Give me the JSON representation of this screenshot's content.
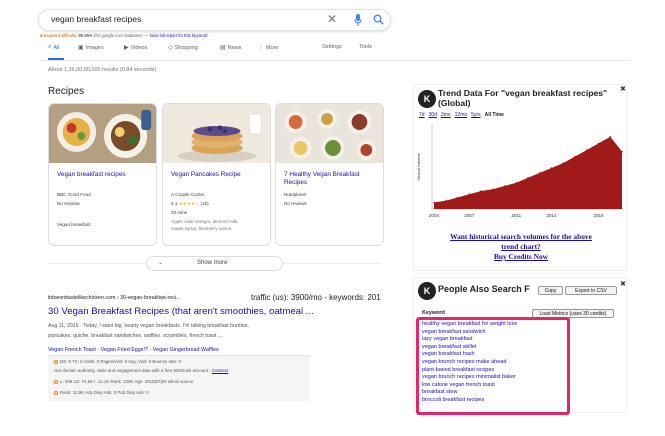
{
  "search": {
    "query": "vegan breakfast recipes",
    "keyword_difficulty_label": "Keyword difficulty:",
    "keyword_difficulty_value": "86.95%",
    "keyword_difficulty_note": "(for google.com database) —",
    "keyword_difficulty_link": "View full report for this keyword"
  },
  "tabs": [
    {
      "label": "All",
      "icon": "search-icon"
    },
    {
      "label": "Images",
      "icon": "image-icon"
    },
    {
      "label": "Videos",
      "icon": "video-icon"
    },
    {
      "label": "Shopping",
      "icon": "tag-icon"
    },
    {
      "label": "News",
      "icon": "news-icon"
    },
    {
      "label": "More",
      "icon": "more-icon"
    },
    {
      "label": "Settings"
    },
    {
      "label": "Tools"
    }
  ],
  "results_count": "About 1,26,00,00,000 results (0.84 seconds)",
  "recipes": {
    "title": "Recipes",
    "cards": [
      {
        "title": "Vegan breakfast recipes",
        "source": "BBC Good Food",
        "reviews": "No reviews",
        "extra": "Vegan breakfast"
      },
      {
        "title": "Vegan Pancakes Recipe",
        "source": "A Couple Cooks",
        "rating": "4.1",
        "stars": "★★★★☆",
        "count": "(18)",
        "time": "20 mins",
        "ingredients_1": "Apple cider vinegar, almond milk,",
        "ingredients_2": "maple syrup, blueberry sauce,"
      },
      {
        "title": "7 Healthy Vegan Breakfast Recipes",
        "source": "Nutriplanet",
        "reviews": "No reviews"
      }
    ],
    "show_more": "Show more"
  },
  "result": {
    "url": "itdoesnttastelikechicken.com › 30-vegan-breakfast-reci...",
    "traffic": "traffic (us): 3900/mo - keywords: 201",
    "title": "30 Vegan Breakfast Recipes (that aren't smoothies, oatmeal ...",
    "snippet_1": "Aug 11, 2016 · Today, I want big, hearty vegan breakfasts. I'm talking breakfast burritos,",
    "snippet_2": "pancakes, quiche, breakfast sandwiches, waffles, scrambles, french toast ...",
    "links": "Vegan French Toast · Vegan Fried Eggs!? · Vegan Gingerbread Waffles"
  },
  "seo_bar": {
    "line1": "DS: 0   TS: 0   Visits: 0   Pages/Visit: 0   Avg. Visit: 0   Bounce rate: 0",
    "line2": "Get domain authority, visits and engagement data with a free SEMrush account -",
    "line2_link": "Connect",
    "line3": "L: 399   LD: 74.5K   I: 14.1K   Rank: 109K   Age: 2015|07|06   whois   source",
    "line4": "Rank: 12.9K   Adv Disp Ads: 0   Pub Disp Ads: 0"
  },
  "trend": {
    "logo": "K",
    "title": "Trend Data For \"vegan breakfast recipes\" (Global)",
    "ranges": [
      "7d",
      "30d",
      "3mo",
      "12mo",
      "5yrs",
      "All Time"
    ],
    "selected_range": "All Time",
    "link_1": "Want historical search volumes for the above",
    "link_2": "trend chart?",
    "link_3": "Buy Credits Now"
  },
  "chart_data": {
    "type": "area",
    "ylabel": "Search Interest",
    "x_ticks": [
      "2004",
      "2007",
      "2011",
      "2014",
      "2018"
    ],
    "x": [
      2004,
      2005,
      2006,
      2007,
      2008,
      2009,
      2010,
      2011,
      2012,
      2013,
      2014,
      2015,
      2016,
      2017,
      2018,
      2019,
      2020
    ],
    "values": [
      8,
      10,
      14,
      18,
      22,
      24,
      28,
      32,
      38,
      44,
      50,
      56,
      64,
      72,
      80,
      88,
      70
    ],
    "color": "#a11a1a"
  },
  "paa": {
    "logo": "K",
    "title": "People Also Search F",
    "copy": "Copy",
    "export": "Export to CSV",
    "load_metrics": "Load Metrics (uses 30 credits)",
    "keyword_header": "Keyword",
    "keywords": [
      "healthy vegan breakfast for weight lose",
      "vegan breakfast sandwich",
      "lazy vegan breakfast",
      "vegan breakfast skillet",
      "vegan breakfast hash",
      "vegan brunch recipes make ahead",
      "plant-based breakfast recipes",
      "vegan brunch recipes minimalist baker",
      "low calorie vegan french toast",
      "breakfast stew",
      "broccoli breakfast recipes"
    ]
  },
  "colors": {
    "accent": "#1a73e8",
    "link": "#1a0dab",
    "highlight": "#e3266d",
    "chart": "#a11a1a"
  }
}
